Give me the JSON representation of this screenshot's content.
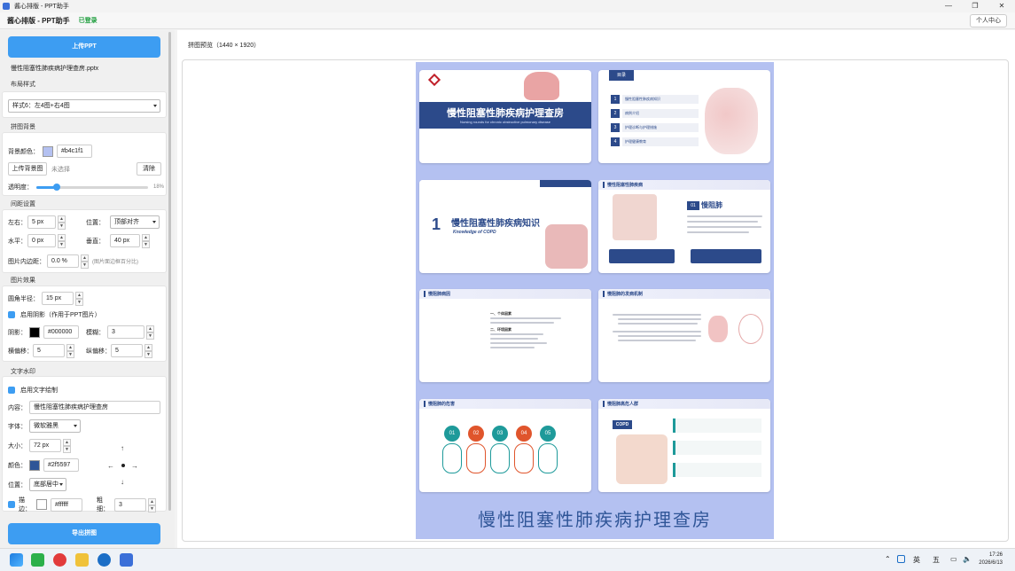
{
  "window": {
    "title": "酱心排版 - PPT助手",
    "controls": [
      "minimize",
      "maximize",
      "close"
    ]
  },
  "header": {
    "app_name": "酱心排版 - PPT助手",
    "status": "已登录",
    "user_center": "个人中心"
  },
  "upload": {
    "button": "上传PPT",
    "filename": "慢性阻塞性肺疾病护理查房.pptx"
  },
  "layout": {
    "title": "布局样式",
    "selected": "样式6：左4图+右4图"
  },
  "background": {
    "title": "拼图背景",
    "color_label": "背景颜色：",
    "color_value": "#b4c1f1",
    "upload_label": "上传背景图",
    "upload_status": "未选择",
    "clear": "清除",
    "opacity_label": "透明度：",
    "opacity_value": "18%",
    "opacity_fraction": 0.18
  },
  "spacing": {
    "title": "间距设置",
    "lr_label": "左右：",
    "lr_value": "5 px",
    "pos_label": "位置：",
    "pos_value": "顶部对齐",
    "h_label": "水平：",
    "h_value": "0 px",
    "v_label": "垂直：",
    "v_value": "40 px",
    "pad_label": "图片内边距：",
    "pad_value": "0.0 %",
    "pad_hint": "(图片面边框百分比)"
  },
  "effects": {
    "title": "图片效果",
    "radius_label": "圆角半径：",
    "radius_value": "15 px",
    "shadow_label": "启用阴影（作用于PPT图片）",
    "shadow_color_label": "阴影：",
    "shadow_color_value": "#000000",
    "blur_label": "模糊：",
    "blur_value": "3",
    "hoff_label": "横偏移：",
    "hoff_value": "5",
    "voff_label": "纵偏移：",
    "voff_value": "5"
  },
  "watermark": {
    "title": "文字水印",
    "enable_label": "启用文字绘制",
    "content_label": "内容：",
    "content_value": "慢性阻塞性肺疾病护理查房",
    "font_label": "字体：",
    "font_value": "微软雅黑",
    "size_label": "大小：",
    "size_value": "72 px",
    "color_label": "颜色：",
    "color_value": "#2f5597",
    "pos_label": "位置：",
    "pos_value": "底部居中",
    "stroke_label": "描边：",
    "stroke_color": "#ffffff",
    "thick_label": "粗细：",
    "thick_value": "3"
  },
  "export": {
    "button": "导出拼图"
  },
  "preview": {
    "title": "拼图预览（1440 × 1920）",
    "slides": {
      "s1_title": "慢性阻塞性肺疾病护理查房",
      "s1_sub": "Nursing rounds for chronic obstructive pulmonary disease",
      "s2_badge": "目录",
      "s2_items": [
        "慢性阻塞性肺疾病知识",
        "病例介绍",
        "护理诊断与护理措施",
        "护理健康教育"
      ],
      "s3_num": "1",
      "s3_title": "慢性阻塞性肺疾病知识",
      "s3_sub": "Knowledge of COPD",
      "s4_title": "慢性阻塞性肺疾病",
      "s4_num": "01",
      "s4_head": "慢阻肺",
      "s5_title": "慢阻肺病因",
      "s5_h1": "一、个体因素",
      "s5_h2": "二、环境因素",
      "s6_title": "慢阻肺的发病机制",
      "s7_title": "慢阻肺的危害",
      "s7_nums": [
        "01",
        "02",
        "03",
        "04",
        "05"
      ],
      "s8_title": "慢阻肺高危人群",
      "s8_logo": "COPD"
    },
    "watermark_text": "慢性阻塞性肺疾病护理查房"
  },
  "taskbar": {
    "ime_lang": "英",
    "ime_day": "五",
    "time": "17:26",
    "date": "2026/6/13"
  },
  "colors": {
    "accent": "#3d9df2",
    "navy": "#2c4a8a",
    "canvas_bg": "#b4c1f1",
    "watermark": "#2f5597"
  }
}
